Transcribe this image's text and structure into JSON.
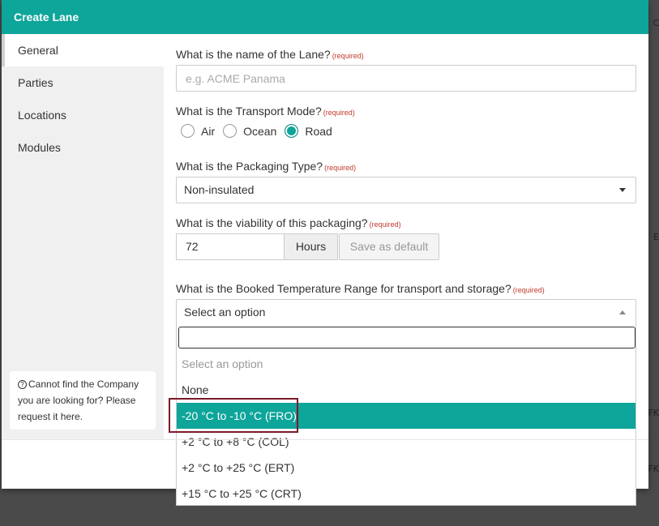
{
  "modal": {
    "title": "Create Lane"
  },
  "sidebar": {
    "items": [
      {
        "label": "General"
      },
      {
        "label": "Parties"
      },
      {
        "label": "Locations"
      },
      {
        "label": "Modules"
      }
    ],
    "help_text": "Cannot find the Company you are looking for? Please request it here."
  },
  "form": {
    "required_tag": "(required)",
    "name": {
      "label": "What is the name of the Lane?",
      "placeholder": "e.g. ACME Panama",
      "value": ""
    },
    "transport_mode": {
      "label": "What is the Transport Mode?",
      "options": [
        "Air",
        "Ocean",
        "Road"
      ],
      "selected": "Road"
    },
    "packaging_type": {
      "label": "What is the Packaging Type?",
      "value": "Non-insulated"
    },
    "viability": {
      "label": "What is the viability of this packaging?",
      "value": "72",
      "unit": "Hours",
      "save_default_label": "Save as default"
    },
    "temperature_range": {
      "label": "What is the Booked Temperature Range for transport and storage?",
      "placeholder": "Select an option",
      "options": [
        "Select an option",
        "None",
        "-20 °C to -10 °C (FRO)",
        "+2 °C to +8 °C (COL)",
        "+2 °C to +25 °C (ERT)",
        "+15 °C to +25 °C (CRT)"
      ],
      "highlighted": "-20 °C to -10 °C (FRO)"
    }
  },
  "background": {
    "fragments": [
      "C",
      "E",
      "FK",
      "FK"
    ]
  },
  "colors": {
    "accent": "#0ea59a",
    "highlight_border": "#7b1a2a"
  }
}
